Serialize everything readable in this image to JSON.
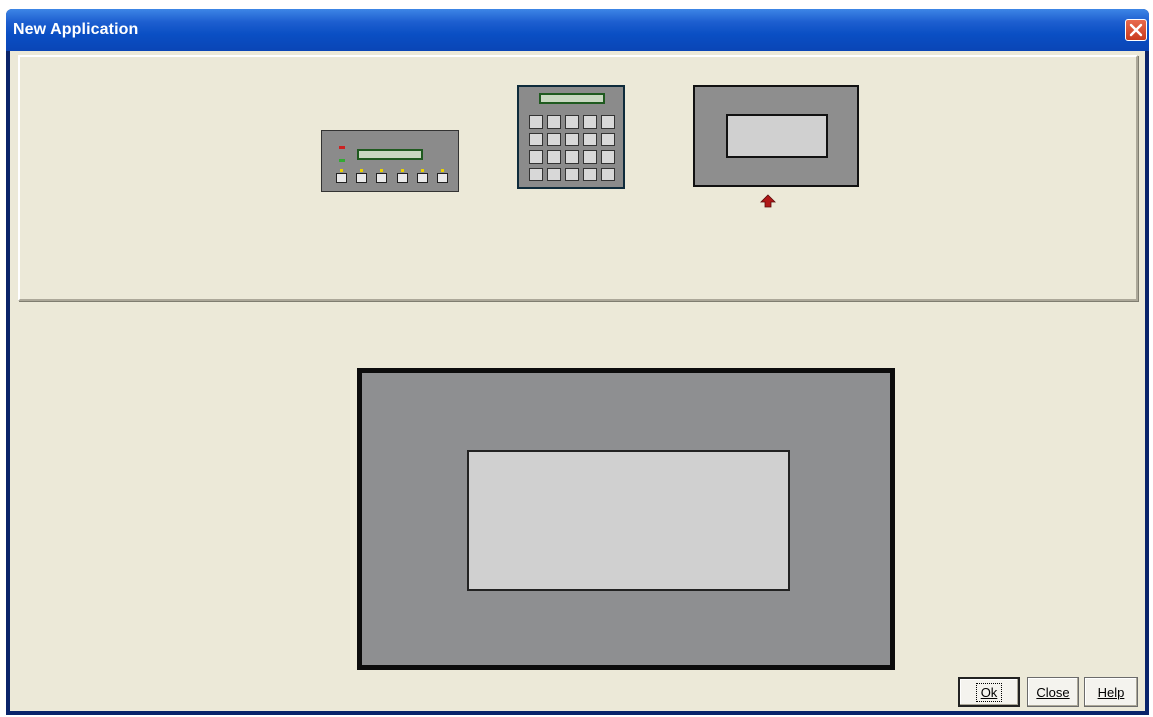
{
  "window": {
    "title": "New Application"
  },
  "title_bar": {
    "close_icon": "close-x-icon"
  },
  "device_picker": {
    "devices": [
      {
        "name": "text-display-keypad",
        "icon": "text-display-6-key-device-icon"
      },
      {
        "name": "numeric-keypad",
        "icon": "numeric-keypad-device-icon"
      },
      {
        "name": "graphic-panel",
        "icon": "graphic-display-panel-icon"
      }
    ],
    "selected_marker_icon": "red-up-arrow-icon",
    "selected_index": 2
  },
  "preview": {
    "icon": "graphic-display-panel-preview"
  },
  "buttons": {
    "ok": "Ok",
    "close": "Close",
    "help": "Help"
  },
  "colors": {
    "title_bar": "#0a4fc4",
    "client_bg": "#ece9d8",
    "panel_gray": "#8e8f91",
    "screen_gray": "#d0d0d0",
    "close_red": "#c93b1d",
    "marker_red": "#b01818"
  }
}
